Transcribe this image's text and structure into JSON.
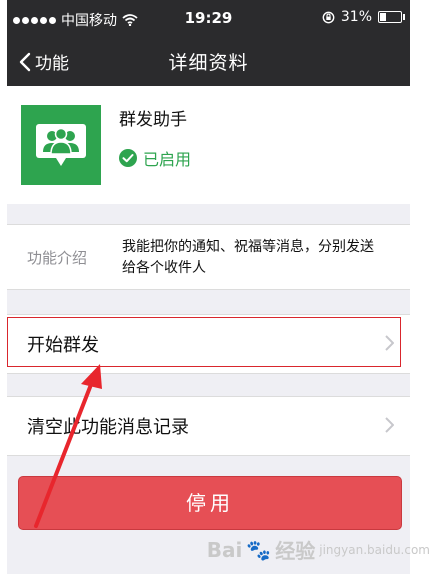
{
  "status_bar": {
    "carrier": "中国移动",
    "time": "19:29",
    "battery": "31%",
    "battery_level": 0.31
  },
  "nav": {
    "back_label": "功能",
    "title": "详细资料"
  },
  "plugin": {
    "name": "群发助手",
    "status": "已启用"
  },
  "intro": {
    "label": "功能介绍",
    "text": "我能把你的通知、祝福等消息，分别发送给各个收件人"
  },
  "rows": [
    {
      "label": "开始群发"
    },
    {
      "label": "清空此功能消息记录"
    }
  ],
  "disable_button": "停用",
  "watermark": {
    "brand": "Bai",
    "suffix": "经验",
    "sub": "jingyan.baidu.com"
  },
  "colors": {
    "accent_green": "#2ea44f",
    "danger": "#e64f55",
    "nav_bg": "#2b2b2d",
    "annotation_red": "#e8262d"
  }
}
